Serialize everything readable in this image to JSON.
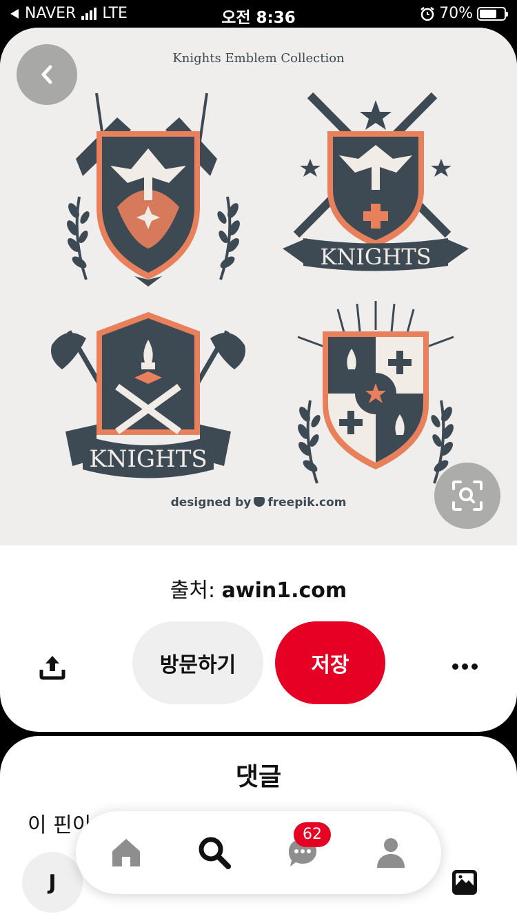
{
  "status_bar": {
    "carrier": "NAVER",
    "network": "LTE",
    "time": "오전 8:36",
    "battery": "70%",
    "battery_level": 0.7
  },
  "pin": {
    "image": {
      "title": "Knights Emblem Collection",
      "banner_text": "KNIGHTS",
      "credit_prefix": "designed by",
      "credit_site": "freepik.com"
    },
    "source_label": "출처:",
    "source_domain": "awin1.com",
    "visit_label": "방문하기",
    "save_label": "저장"
  },
  "comments": {
    "title": "댓글",
    "text": "이 핀이 마",
    "avatar_initial": "J"
  },
  "nav": {
    "badge_count": "62",
    "items": [
      "home-icon",
      "search-icon",
      "chat-icon",
      "profile-icon"
    ]
  },
  "colors": {
    "brand_red": "#e60023",
    "emblem_navy": "#3d4a54",
    "emblem_orange": "#e8805c"
  }
}
